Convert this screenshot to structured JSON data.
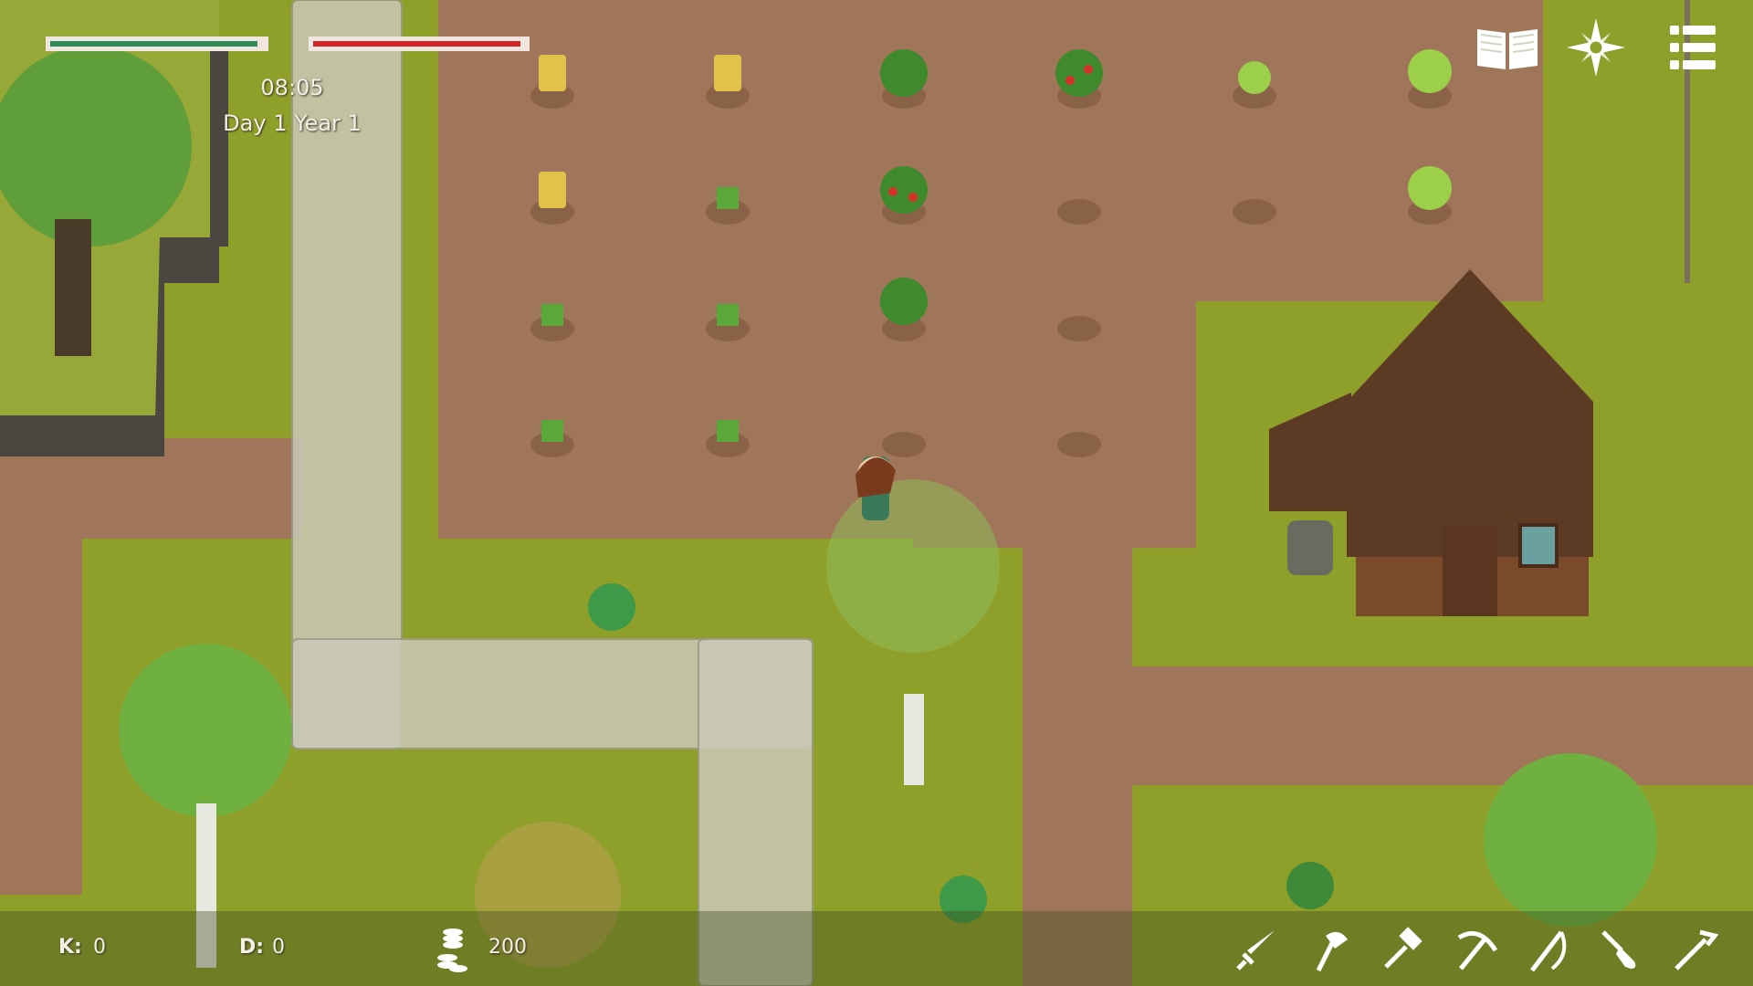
{
  "hud": {
    "health_level": 0.97,
    "stamina_level": 0.98,
    "time": "08:05",
    "date": "Day 1 Year 1",
    "k_label": "K:",
    "k_value": "0",
    "d_label": "D:",
    "d_value": "0",
    "coins": "200"
  },
  "top_buttons": [
    {
      "name": "journal-book-button",
      "icon": "open-book-icon"
    },
    {
      "name": "compass-button",
      "icon": "compass-icon"
    },
    {
      "name": "menu-button",
      "icon": "list-menu-icon"
    }
  ],
  "toolbar": [
    {
      "name": "tool-sword",
      "icon": "sword-icon"
    },
    {
      "name": "tool-axe",
      "icon": "axe-icon"
    },
    {
      "name": "tool-hammer",
      "icon": "hammer-icon"
    },
    {
      "name": "tool-pickaxe",
      "icon": "pickaxe-icon"
    },
    {
      "name": "tool-scythe",
      "icon": "scythe-icon"
    },
    {
      "name": "tool-shovel",
      "icon": "shovel-icon"
    },
    {
      "name": "tool-hoe",
      "icon": "hoe-icon"
    }
  ],
  "colors": {
    "grass": "#8fa02a",
    "dirt": "#a0765a",
    "health": "#2e8b57",
    "stamina": "#d42424",
    "wood": "#6b4227"
  }
}
